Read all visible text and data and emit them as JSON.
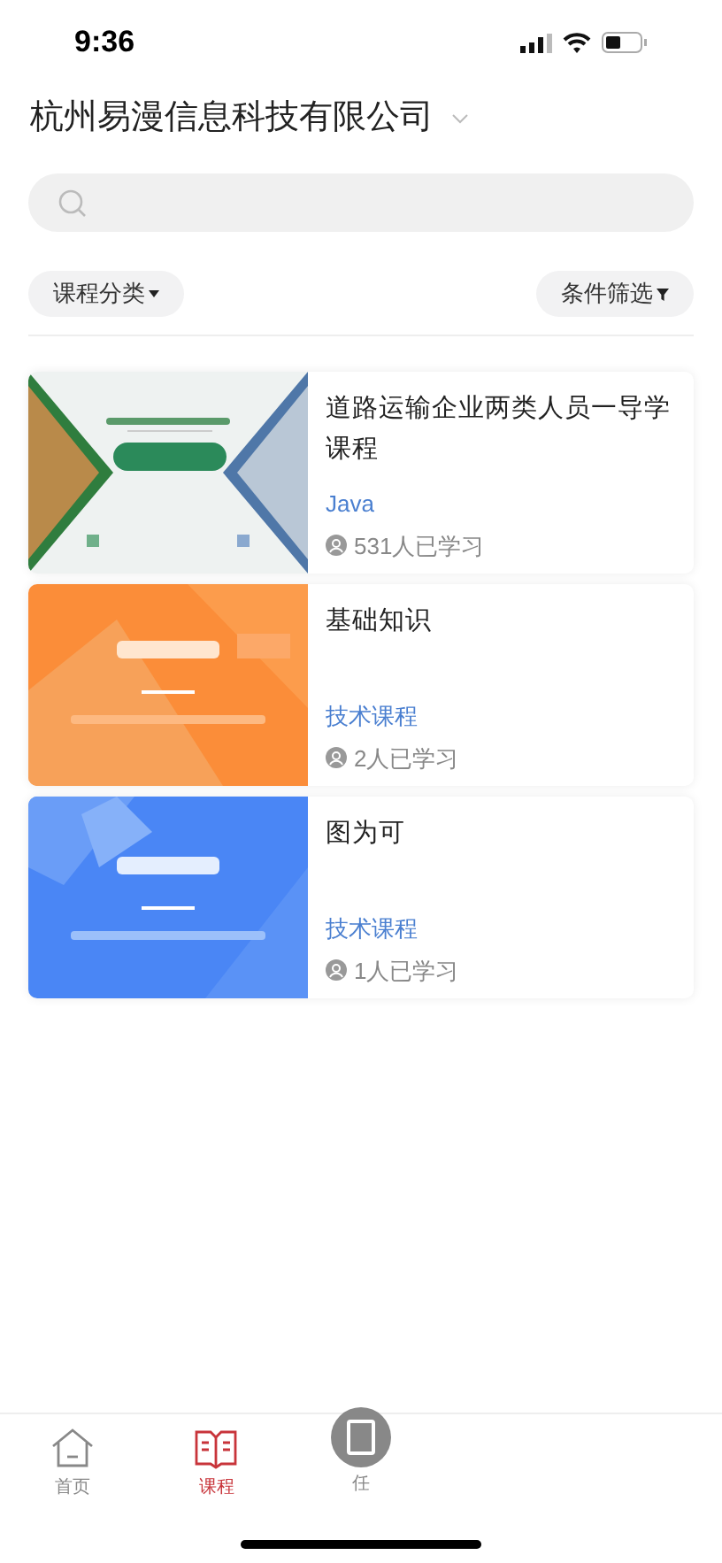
{
  "status_bar": {
    "time": "9:36"
  },
  "header": {
    "title": "杭州易漫信息科技有限公司"
  },
  "filters": [
    {
      "label": "课程分类",
      "kind": "category"
    },
    {
      "label": "条件筛选",
      "kind": "filter"
    }
  ],
  "courses": [
    {
      "title": "道路运输企业两类人员一导学课程",
      "category": "Java",
      "learners": "531人已学习"
    },
    {
      "title": "基础知识",
      "category": "技术课程",
      "learners": "2人已学习"
    },
    {
      "title": "图为可",
      "category": "技术课程",
      "learners": "1人已学习"
    }
  ],
  "tab_bar": [
    {
      "label": "首页",
      "kind": "home",
      "selected": false
    },
    {
      "label": "课程",
      "kind": "book",
      "selected": true
    },
    {
      "label": "任",
      "kind": "center",
      "selected": false
    }
  ]
}
